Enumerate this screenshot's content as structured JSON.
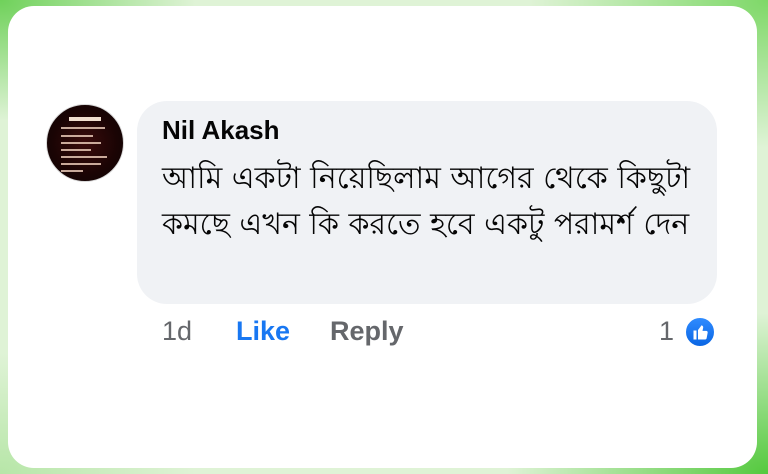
{
  "comment": {
    "author": "Nil Akash",
    "text": "আমি একটা নিয়েছিলাম আগের থেকে কিছুটা কমছে এখন কি করতে হবে একটু পরামর্শ দেন",
    "time": "1d",
    "like_label": "Like",
    "reply_label": "Reply",
    "reaction_count": "1"
  },
  "colors": {
    "like": "#1877f2",
    "muted": "#65676b",
    "bubble": "#f0f2f5",
    "background_green": "#dff3d6"
  },
  "icons": {
    "reaction": "thumbs-up-icon"
  }
}
